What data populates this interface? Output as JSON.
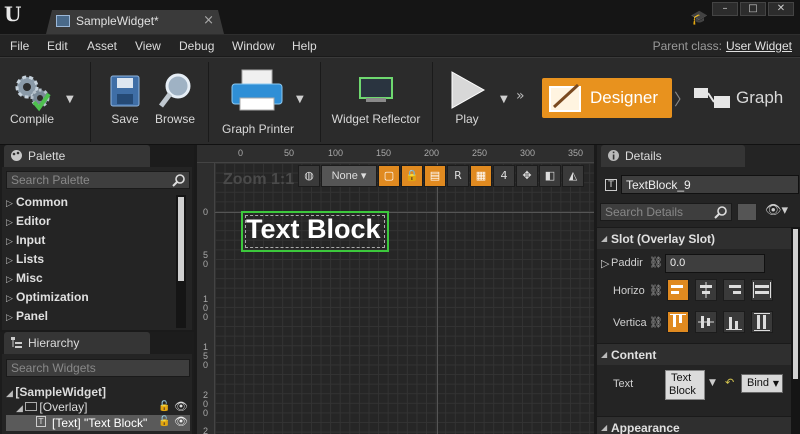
{
  "window": {
    "tab_label": "SampleWidget*",
    "tab_close": "×",
    "minimize": "–",
    "maximize": "□",
    "close": "✕"
  },
  "menu": {
    "items": [
      "File",
      "Edit",
      "Asset",
      "View",
      "Debug",
      "Window",
      "Help"
    ],
    "parent_class_label": "Parent class:",
    "parent_class_value": "User Widget"
  },
  "toolbar": {
    "compile": "Compile",
    "save": "Save",
    "browse": "Browse",
    "graph_printer": "Graph Printer",
    "widget_reflector": "Widget Reflector",
    "play": "Play",
    "designer": "Designer",
    "graph": "Graph",
    "colors": {
      "designer_bg": "#e8921e",
      "play_icon": "#d8d8d8"
    }
  },
  "palette": {
    "title": "Palette",
    "search_placeholder": "Search Palette",
    "categories": [
      "Common",
      "Editor",
      "Input",
      "Lists",
      "Misc",
      "Optimization",
      "Panel"
    ]
  },
  "hierarchy": {
    "title": "Hierarchy",
    "search_placeholder": "Search Widgets",
    "items": [
      "[SampleWidget]",
      "[Overlay]",
      "[Text] \"Text Block\""
    ]
  },
  "canvas": {
    "zoom_label": "Zoom 1:1",
    "none_dropdown": "None",
    "r_button": "R",
    "grid_size": "4",
    "top_ruler": [
      "0",
      "50",
      "100",
      "150",
      "200",
      "250",
      "300",
      "350"
    ],
    "left_ruler": [
      "0",
      "5\n0",
      "1\n0\n0",
      "1\n5\n0",
      "2\n0\n0",
      "2"
    ],
    "widget_text": "Text Block",
    "colors": {
      "selection": "#3cc83c",
      "tool_active": "#e08a20"
    }
  },
  "details": {
    "title": "Details",
    "widget_name": "TextBlock_9",
    "search_placeholder": "Search Details",
    "slot_section": "Slot (Overlay Slot)",
    "padding_label": "Paddir",
    "padding_value": "0.0",
    "horizontal_label": "Horizo",
    "vertical_label": "Vertica",
    "content_section": "Content",
    "text_label": "Text",
    "text_value_line1": "Text",
    "text_value_line2": "Block",
    "bind_label": "Bind",
    "appearance_section": "Appearance",
    "horizontal_alignment": {
      "active": 0,
      "count": 4
    },
    "vertical_alignment": {
      "active": 0,
      "count": 4
    }
  }
}
